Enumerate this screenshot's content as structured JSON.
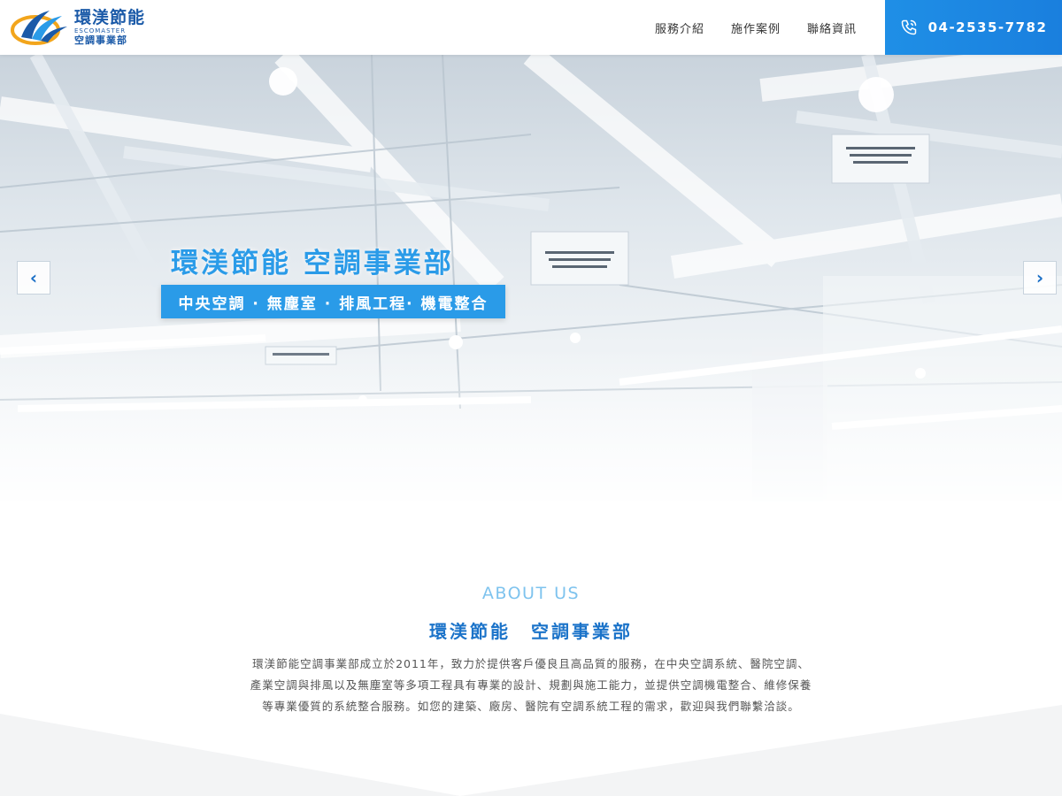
{
  "header": {
    "logo": {
      "title": "環渼節能",
      "en": "ESCOMASTER",
      "sub": "空調事業部"
    },
    "nav": [
      {
        "label": "服務介紹"
      },
      {
        "label": "施作案例"
      },
      {
        "label": "聯絡資訊"
      }
    ],
    "phone": {
      "icon": "phone-icon",
      "number": "04-2535-7782"
    }
  },
  "hero": {
    "title": "環渼節能 空調事業部",
    "banner": "中央空調 · 無塵室 · 排風工程· 機電整合",
    "prev_icon": "chevron-left-icon",
    "next_icon": "chevron-right-icon",
    "prev_glyph": "‹",
    "next_glyph": "›"
  },
  "about": {
    "eyebrow": "ABOUT US",
    "title": "環渼節能　空調事業部",
    "text": "環渼節能空調事業部成立於2011年，致力於提供客戶優良且高品質的服務，在中央空調系統、醫院空調、產業空調與排風以及無塵室等多項工程具有專業的設計、規劃與施工能力，並提供空調機電整合、維修保養等專業優質的系統整合服務。如您的建築、廠房、醫院有空調系統工程的需求，歡迎與我們聯繫洽談。"
  },
  "colors": {
    "brand_blue": "#1b5aa8",
    "accent_blue": "#2a9be8",
    "phone_bg": "#1f8fe6"
  }
}
